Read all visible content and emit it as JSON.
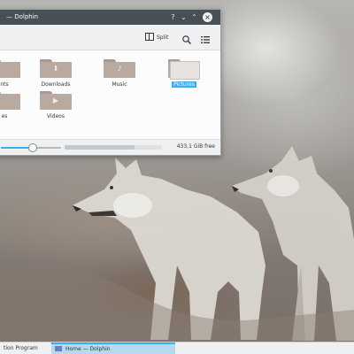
{
  "window": {
    "title": "Home — Dolphin",
    "title_visible": "— Dolphin",
    "help_glyph": "?",
    "min_glyph": "⌄",
    "max_glyph": "⌃",
    "close_glyph": "×"
  },
  "toolbar": {
    "split_label": "Split",
    "search_icon": "search-icon",
    "menu_icon": "hamburger-menu-icon"
  },
  "folders": [
    {
      "label": "nts",
      "icon": "download-folder-icon",
      "emblem": ""
    },
    {
      "label": "Downloads",
      "icon": "download-folder-icon",
      "emblem": "⬇"
    },
    {
      "label": "Music",
      "icon": "music-folder-icon",
      "emblem": "♪"
    },
    {
      "label": "Pictures",
      "icon": "pictures-folder-icon",
      "emblem": "",
      "selected": true
    },
    {
      "label": "es",
      "icon": "folder-icon",
      "emblem": ""
    },
    {
      "label": "Videos",
      "icon": "video-folder-icon",
      "emblem": "▶"
    }
  ],
  "statusbar": {
    "zoom_level": 0.52,
    "space_used_fraction": 0.72,
    "free_space": "433,1 GiB free"
  },
  "taskbar": {
    "task_1": "tion Program",
    "task_2": "Home — Dolphin"
  },
  "colors": {
    "accent": "#3daee9",
    "titlebar": "#475057",
    "folder": "#b8a9a1"
  }
}
